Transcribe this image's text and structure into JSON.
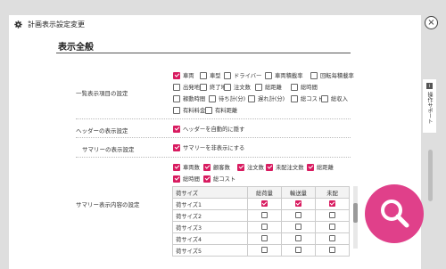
{
  "dialog": {
    "title": "計画表示設定変更",
    "close_glyph": "×"
  },
  "section": {
    "title": "表示全般"
  },
  "rows": {
    "list_items": {
      "label": "一覧表示項目の設定"
    },
    "header": {
      "label": "ヘッダーの表示設定"
    },
    "summary": {
      "label": "サマリーの表示設定"
    },
    "summary_content": {
      "label": "サマリー表示内容の設定"
    }
  },
  "list_options": [
    {
      "label": "車両",
      "checked": true
    },
    {
      "label": "車型",
      "checked": false
    },
    {
      "label": "ドライバー",
      "checked": false
    },
    {
      "label": "車両積載率",
      "checked": false
    },
    {
      "label": "回転毎積載率",
      "checked": false
    },
    {
      "label": "出発地",
      "checked": false
    },
    {
      "label": "終了地",
      "checked": false
    },
    {
      "label": "注文数",
      "checked": false
    },
    {
      "label": "総距離",
      "checked": false
    },
    {
      "label": "総時間",
      "checked": false
    },
    {
      "label": "稼動時間",
      "checked": false
    },
    {
      "label": "待ち計(分)",
      "checked": false
    },
    {
      "label": "遅れ計(分)",
      "checked": false
    },
    {
      "label": "総コスト",
      "checked": false
    },
    {
      "label": "総収入",
      "checked": false
    },
    {
      "label": "有料料金",
      "checked": false
    },
    {
      "label": "有料距離",
      "checked": false
    }
  ],
  "header_option": {
    "label": "ヘッダーを自動的に隠す",
    "checked": true
  },
  "summary_option": {
    "label": "サマリーを非表示にする",
    "checked": true
  },
  "summary_options": [
    {
      "label": "車両数",
      "checked": true
    },
    {
      "label": "顧客数",
      "checked": true
    },
    {
      "label": "注文数",
      "checked": true
    },
    {
      "label": "未配注文数",
      "checked": true
    },
    {
      "label": "総距離",
      "checked": true
    },
    {
      "label": "総時間",
      "checked": true
    },
    {
      "label": "総コスト",
      "checked": true
    }
  ],
  "size_table": {
    "headers": [
      "荷サイズ",
      "総荷量",
      "輸送量",
      "未配"
    ],
    "rows": [
      {
        "name": "荷サイズ1",
        "checks": [
          true,
          true,
          true
        ]
      },
      {
        "name": "荷サイズ2",
        "checks": [
          false,
          false,
          false
        ]
      },
      {
        "name": "荷サイズ3",
        "checks": [
          false,
          false,
          false
        ]
      },
      {
        "name": "荷サイズ4",
        "checks": [
          false,
          false,
          false
        ]
      },
      {
        "name": "荷サイズ5",
        "checks": [
          false,
          false,
          false
        ]
      }
    ]
  },
  "side_tab": {
    "label": "操作サポート"
  },
  "colors": {
    "accent": "#d81b60",
    "zoom": "#e0408a"
  },
  "icons": {
    "settings": "gear-icon",
    "close": "close-icon",
    "zoom": "magnifier-icon"
  }
}
